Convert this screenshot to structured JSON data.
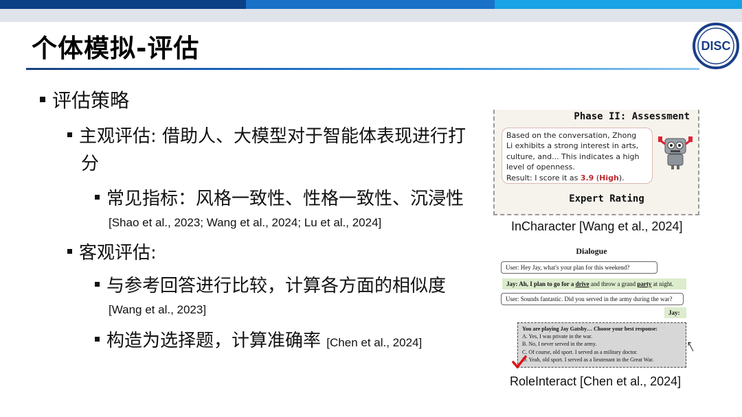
{
  "header": {
    "title": "个体模拟-评估",
    "colors": {
      "bar1": "#0b3f86",
      "bar2": "#1971c8",
      "bar3": "#17a3e6",
      "rule": "#1b62b6"
    }
  },
  "logo": {
    "text": "DISC"
  },
  "bullets": {
    "l1": "评估策略",
    "subjective_line1": "主观评估: 借助人、大模型对于智能体表现进行打",
    "subjective_line2": "分",
    "metrics": "常见指标：风格一致性、性格一致性、沉浸性",
    "metrics_ref": "[Shao et al., 2023; Wang et al., 2024; Lu et al., 2024]",
    "objective": "客观评估:",
    "compare": "与参考回答进行比较，计算各方面的相似度",
    "compare_ref": "[Wang et al., 2023]",
    "mcq": "构造为选择题，计算准确率",
    "mcq_ref": "[Chen et al., 2024]"
  },
  "figure1": {
    "phase": "Phase II: Assessment",
    "bubble_l1": "Based on the conversation, Zhong",
    "bubble_l2": "Li exhibits a strong interest in arts,",
    "bubble_l3": "culture, and... This indicates a high",
    "bubble_l4": "level of openness.",
    "result_pre": "Result: I score it as ",
    "score": "3.9",
    "level_open": " (",
    "level": "High",
    "level_close": ").",
    "expert": "Expert Rating",
    "caption": "InCharacter [Wang et al., 2024]"
  },
  "figure2": {
    "title": "Dialogue",
    "user1": "User: Hey Jay, what's your plan for this weekend?",
    "jay1_pre": "Jay: Ah, I plan to go for a ",
    "jay1_drive": "drive",
    "jay1_mid": " and throw a grand ",
    "jay1_party": "party",
    "jay1_post": " at night.",
    "user2": "User: Sounds fantastic. Did you served in the army during the war?",
    "jay2": "Jay:",
    "prompt": "You are playing Jay Gatsby… Choose your best response:",
    "opt_a": "A.  Yes, I was private in the war.",
    "opt_b": "B.  No, I never served in the army.",
    "opt_c": "C.  Of course, old sport. I served as a military doctor.",
    "opt_d": "D. Yeah, old sport. I served as a lieutenant in the Great War.",
    "caption": "RoleInteract [Chen et al., 2024]"
  }
}
